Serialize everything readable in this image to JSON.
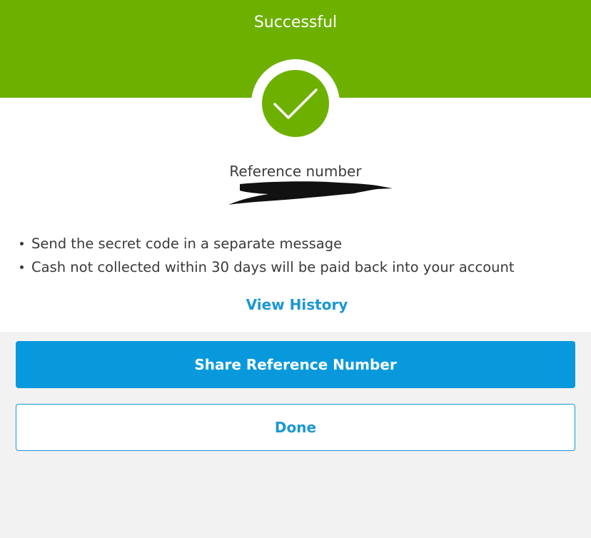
{
  "header": {
    "title": "Successful",
    "color": "#6db000"
  },
  "status_icon": "checkmark-icon",
  "reference": {
    "label": "Reference number"
  },
  "notes": [
    "Send the secret code in a separate message",
    "Cash not collected within 30 days will be paid back into your account"
  ],
  "links": {
    "view_history": "View History"
  },
  "buttons": {
    "share": "Share Reference Number",
    "done": "Done"
  },
  "colors": {
    "accent": "#1b97d0",
    "primary_button": "#0899dc",
    "success": "#6db000"
  }
}
